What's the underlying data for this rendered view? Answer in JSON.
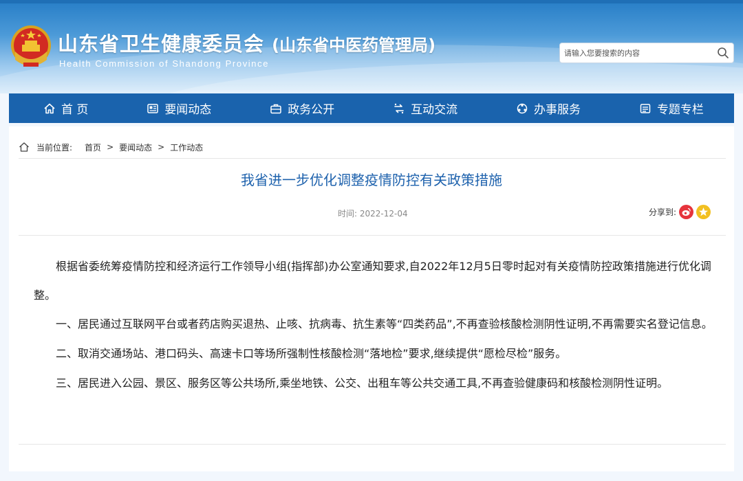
{
  "header": {
    "title": "山东省卫生健康委员会",
    "subtitle": "(山东省中医药管理局)",
    "english": "Health Commission of Shandong Province",
    "search_placeholder": "请输入您要搜索的内容"
  },
  "nav": [
    {
      "label": "首 页",
      "icon": "home-icon"
    },
    {
      "label": "要闻动态",
      "icon": "newspaper-icon"
    },
    {
      "label": "政务公开",
      "icon": "briefcase-icon"
    },
    {
      "label": "互动交流",
      "icon": "interaction-icon"
    },
    {
      "label": "办事服务",
      "icon": "service-icon"
    },
    {
      "label": "专题专栏",
      "icon": "column-icon"
    }
  ],
  "breadcrumb": {
    "label": "当前位置:",
    "items": [
      "首页",
      "要闻动态",
      "工作动态"
    ],
    "separator": ">"
  },
  "article": {
    "title": "我省进一步优化调整疫情防控有关政策措施",
    "time": "时间:  2022-12-04",
    "share_label": "分享到:",
    "paragraphs": [
      "根据省委统筹疫情防控和经济运行工作领导小组(指挥部)办公室通知要求,自2022年12月5日零时起对有关疫情防控政策措施进行优化调整。",
      "一、居民通过互联网平台或者药店购买退热、止咳、抗病毒、抗生素等“四类药品”,不再查验核酸检测阴性证明,不再需要实名登记信息。",
      "二、取消交通场站、港口码头、高速卡口等场所强制性核酸检测“落地检”要求,继续提供“愿检尽检”服务。",
      "三、居民进入公园、景区、服务区等公共场所,乘坐地铁、公交、出租车等公共交通工具,不再查验健康码和核酸检测阴性证明。"
    ]
  },
  "colors": {
    "nav_bg": "#1a63ad",
    "title_blue": "#1e62ad",
    "weibo_red": "#e6343c",
    "star_yellow": "#f2c021"
  }
}
